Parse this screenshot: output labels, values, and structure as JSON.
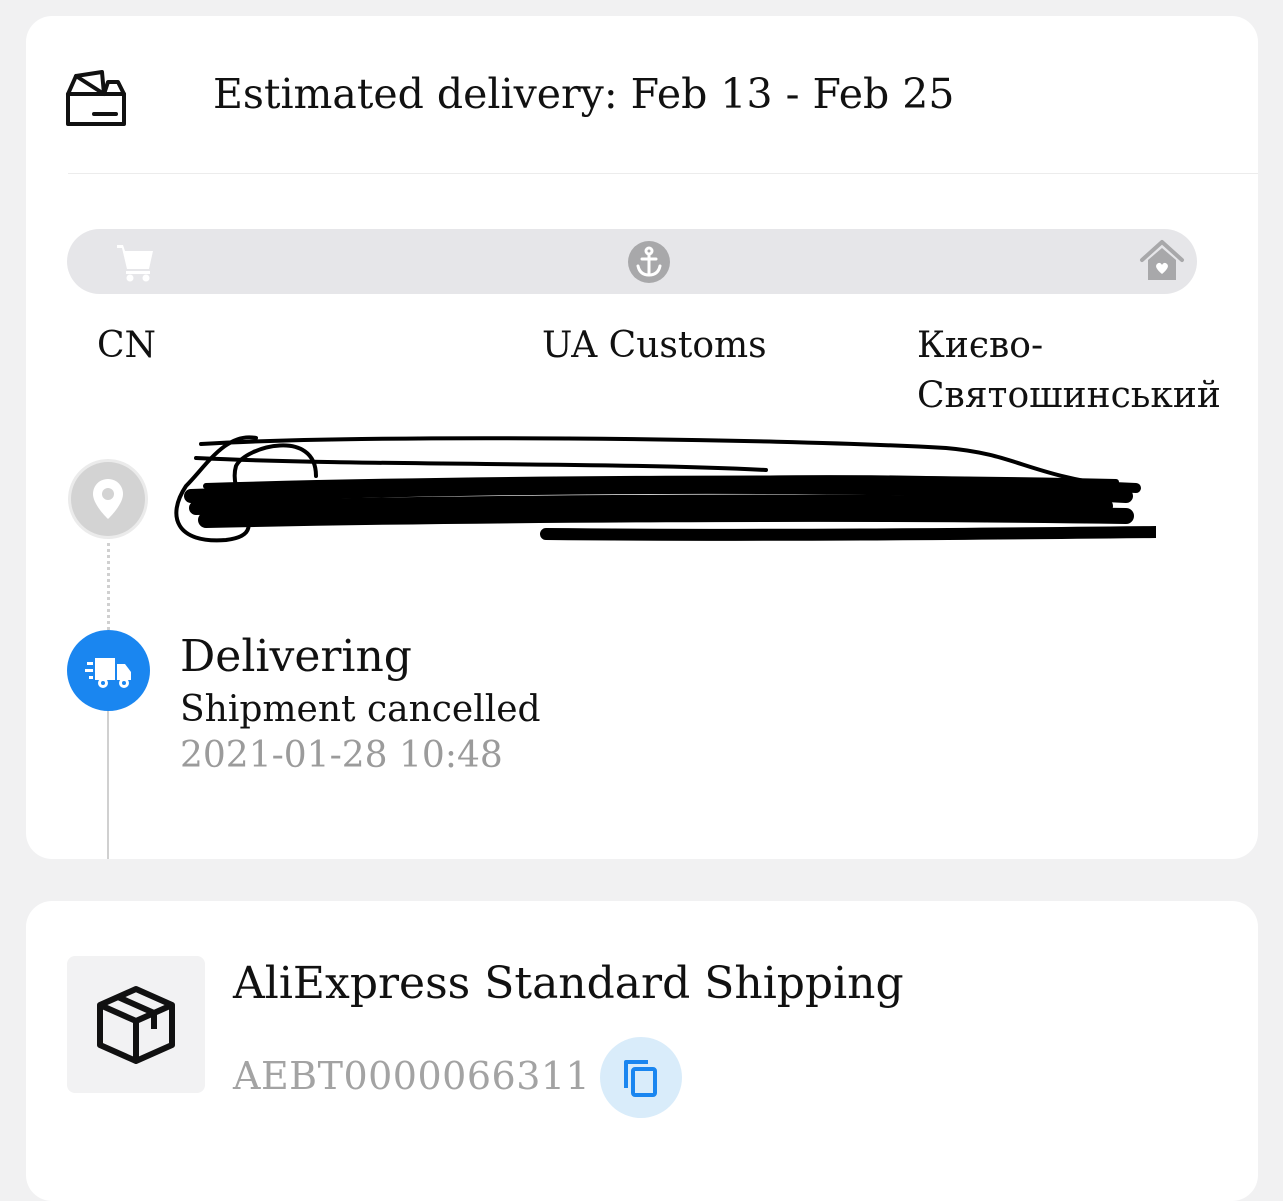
{
  "delivery": {
    "eta": "Estimated delivery: Feb 13 - Feb 25"
  },
  "progress": {
    "icons": [
      "cart-icon",
      "anchor-icon",
      "home-icon"
    ],
    "stages": [
      "CN",
      "UA Customs",
      "Києво-Святошинський"
    ],
    "stage_city_line1": "Києво-",
    "stage_city_line2": "Святошинський"
  },
  "timeline": {
    "location_redacted": true,
    "event": {
      "title": "Delivering",
      "detail": "Shipment cancelled",
      "time": "2021-01-28 10:48"
    }
  },
  "shipping": {
    "method": "AliExpress Standard Shipping",
    "tracking_number": "AEBT0000066311"
  },
  "colors": {
    "page_background": "#f1f1f2",
    "card_background": "#ffffff",
    "accent_blue": "#1a86f0",
    "copy_button_bg": "#d9ecfa",
    "muted_text": "#9b9b9b",
    "progress_track": "#e6e6e9"
  }
}
